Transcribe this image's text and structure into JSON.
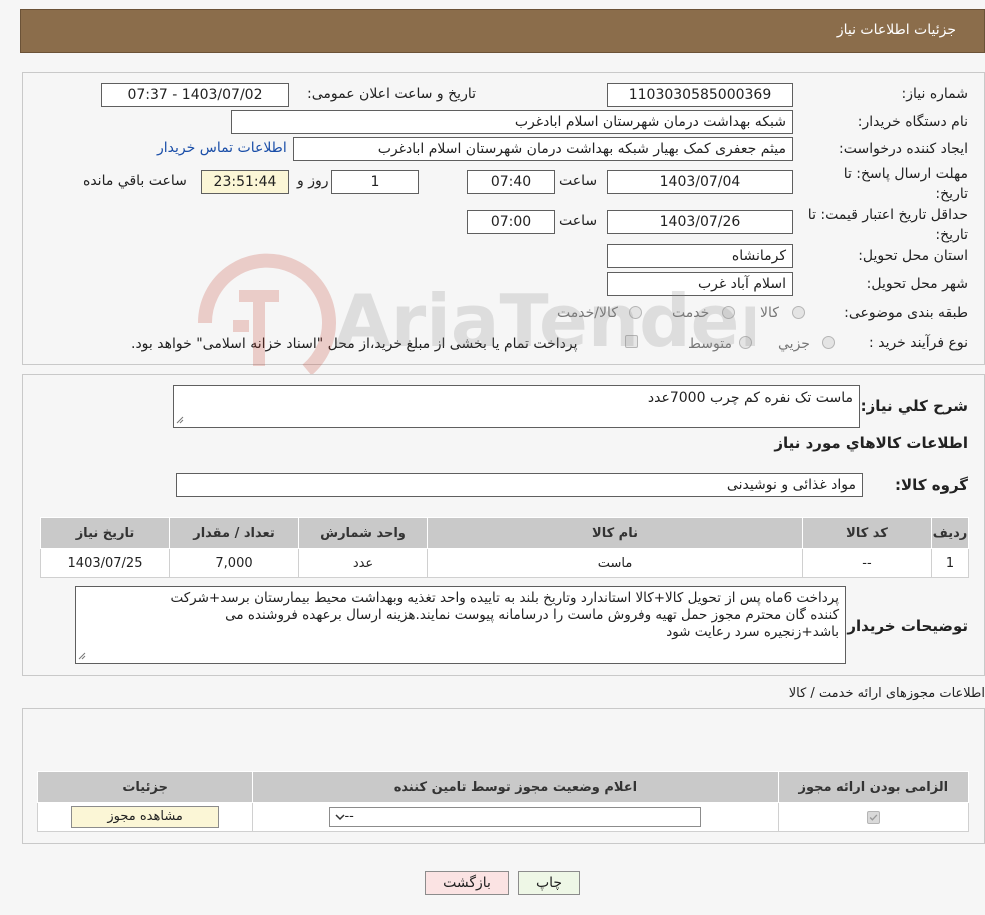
{
  "header": {
    "title": "جزئیات اطلاعات نیاز"
  },
  "info": {
    "need_number_label": "شماره نیاز:",
    "need_number": "1103030585000369",
    "announce_label": "تاریخ و ساعت اعلان عمومی:",
    "announce_value": "1403/07/02 - 07:37",
    "buyer_org_label": "نام دستگاه خریدار:",
    "buyer_org": "شبکه بهداشت درمان شهرستان اسلام ابادغرب",
    "creator_label": "ایجاد کننده درخواست:",
    "creator": "میثم جعفری کمک بهیار شبکه بهداشت درمان شهرستان اسلام ابادغرب",
    "contact_link": "اطلاعات تماس خریدار",
    "reply_deadline_label": "مهلت ارسال پاسخ: تا تاریخ:",
    "reply_date": "1403/07/04",
    "time_word": "ساعت",
    "reply_time": "07:40",
    "days_value": "1",
    "days_word": "روز و",
    "remaining_time": "23:51:44",
    "remaining_label": "ساعت باقي مانده",
    "price_validity_label": "حداقل تاریخ اعتبار قیمت: تا تاریخ:",
    "price_date": "1403/07/26",
    "price_time": "07:00",
    "province_label": "استان محل تحویل:",
    "province": "کرمانشاه",
    "city_label": "شهر محل تحویل:",
    "city": "اسلام آباد غرب",
    "category_label": "طبقه بندی موضوعی:",
    "category_options": [
      "کالا",
      "خدمت",
      "کالا/خدمت"
    ],
    "process_label": "نوع فرآیند خرید :",
    "process_options": [
      "جزیي",
      "متوسط"
    ],
    "process_note": "پرداخت تمام یا بخشی از مبلغ خرید،از محل \"اسناد خزانه اسلامی\" خواهد بود."
  },
  "description": {
    "label": "شرح کلي نياز:",
    "value": "ماست تک نفره کم چرب 7000عدد",
    "goods_title": "اطلاعات کالاهاي مورد نياز",
    "group_label": "گروه کالا:",
    "group_value": "مواد غذائی و نوشیدنی"
  },
  "goods_table": {
    "headers": [
      "رديف",
      "کد کالا",
      "نام کالا",
      "واحد شمارش",
      "تعداد / مقدار",
      "تاريخ نياز"
    ],
    "rows": [
      [
        "1",
        "--",
        "ماست",
        "عدد",
        "7,000",
        "1403/07/25"
      ]
    ]
  },
  "buyer_notes": {
    "label": "توضیحات خریدار:",
    "line1": "پرداخت 6ماه پس از تحویل کالا+کالا استاندارد وتاریخ بلند به تاییده واحد تغذیه وبهداشت محیط بیمارستان برسد+شرکت",
    "line2": "کننده گان محترم مجوز حمل تهیه وفروش ماست   را درسامانه پیوست نمایند.هزینه ارسال برعهده فروشنده می",
    "line3": "باشد+زنجیره سرد رعایت شود"
  },
  "license": {
    "section_title": "اطلاعات مجوزهای ارائه خدمت / کالا",
    "headers": [
      "الزامی بودن ارائه مجوز",
      "اعلام وضعیت مجوز توسط تامین کننده",
      "جزئیات"
    ],
    "select_value": "--",
    "view_button": "مشاهده مجوز"
  },
  "buttons": {
    "print": "چاپ",
    "back": "بازگشت"
  },
  "watermark": {
    "text": "AriaTender.neT"
  }
}
